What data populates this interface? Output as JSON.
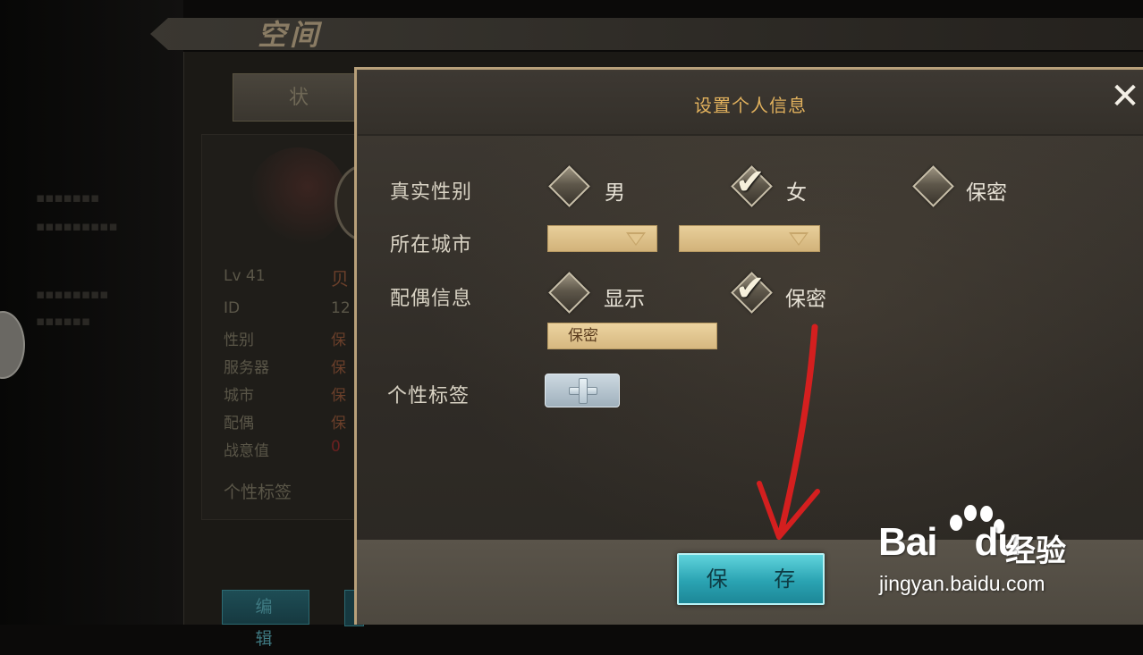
{
  "background": {
    "panel_title": "空间",
    "status_tab": "状 态",
    "profile": {
      "level": "Lv 41",
      "name_partial": "贝",
      "rows": [
        {
          "label": "ID",
          "value": "12"
        },
        {
          "label": "性别",
          "value": "保"
        },
        {
          "label": "服务器",
          "value": "保"
        },
        {
          "label": "城市",
          "value": "保"
        },
        {
          "label": "配偶",
          "value": "保"
        },
        {
          "label": "战意值",
          "value": "0"
        }
      ],
      "tag_title": "个性标签",
      "edit_label": "编 辑"
    }
  },
  "dialog": {
    "title": "设置个人信息",
    "close_glyph": "✕",
    "gender": {
      "label": "真实性别",
      "options": [
        "男",
        "女",
        "保密"
      ],
      "selected": "女"
    },
    "city": {
      "label": "所在城市",
      "province_value": "",
      "city_value": ""
    },
    "spouse": {
      "label": "配偶信息",
      "options": [
        "显示",
        "保密"
      ],
      "selected": "保密",
      "field_value": "保密"
    },
    "tags": {
      "label": "个性标签",
      "add_button": "+"
    },
    "save_label": "保 存",
    "check_glyph": "✔"
  },
  "watermark": {
    "brand": "Bai",
    "brand_tail": "du",
    "cn": "经验",
    "url": "jingyan.baidu.com"
  },
  "colors": {
    "dialog_border": "#b8a07a",
    "title_color": "#e1b15d",
    "save_button": "#2aa3b2",
    "arrow": "#d41f1f"
  }
}
